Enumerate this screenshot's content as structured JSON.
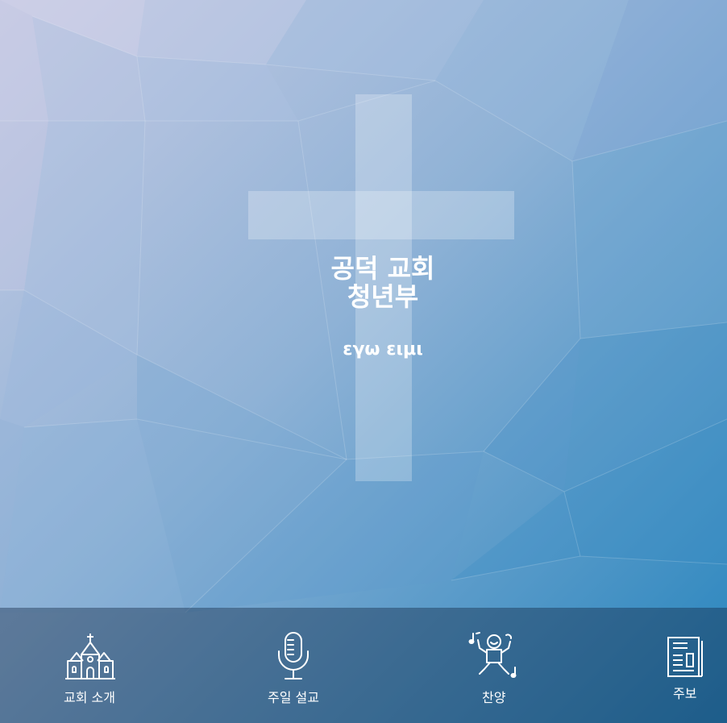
{
  "hero": {
    "title_line1": "공덕 교회",
    "title_line2": "청년부",
    "subtitle": "εγω ειμι"
  },
  "nav": {
    "items": [
      {
        "label": "교회 소개",
        "icon": "church-icon"
      },
      {
        "label": "주일 설교",
        "icon": "microphone-icon"
      },
      {
        "label": "찬양",
        "icon": "singing-person-icon"
      },
      {
        "label": "주보",
        "icon": "newspaper-icon"
      }
    ]
  },
  "colors": {
    "background_light": "#c9cde6",
    "background_dark": "#2b86bd",
    "nav_overlay": "#22344f",
    "text": "#ffffff"
  }
}
